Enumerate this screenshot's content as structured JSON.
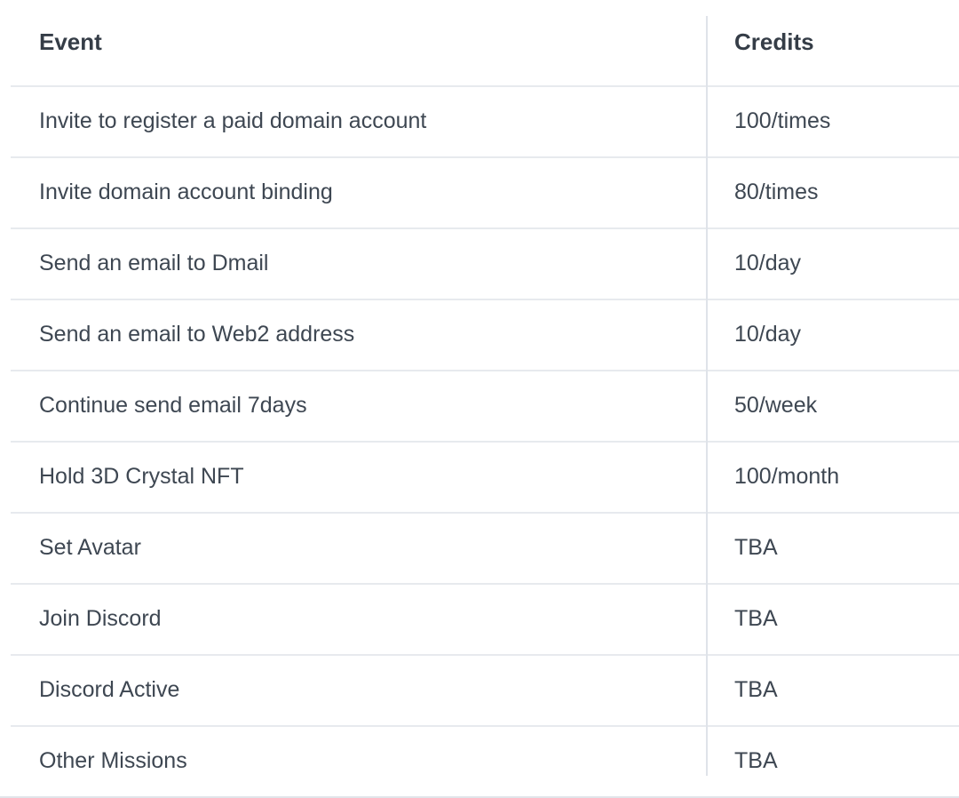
{
  "table": {
    "columns": [
      {
        "key": "event",
        "label": "Event"
      },
      {
        "key": "credits",
        "label": "Credits"
      }
    ],
    "rows": [
      {
        "event": "Invite to register a paid domain account",
        "credits": "100/times"
      },
      {
        "event": "Invite domain account binding",
        "credits": "80/times"
      },
      {
        "event": "Send an email to Dmail",
        "credits": "10/day"
      },
      {
        "event": "Send an email to Web2 address",
        "credits": "10/day"
      },
      {
        "event": "Continue send email 7days",
        "credits": "50/week"
      },
      {
        "event": "Hold 3D Crystal NFT",
        "credits": "100/month"
      },
      {
        "event": "Set Avatar",
        "credits": "TBA"
      },
      {
        "event": "Join Discord",
        "credits": "TBA"
      },
      {
        "event": "Discord Active",
        "credits": "TBA"
      },
      {
        "event": "Other Missions",
        "credits": "TBA"
      }
    ]
  },
  "colors": {
    "background": "#ffffff",
    "header_text": "#353d47",
    "body_text": "#3e4752",
    "row_border": "#e7eaee",
    "column_divider": "#dfe3e9"
  }
}
